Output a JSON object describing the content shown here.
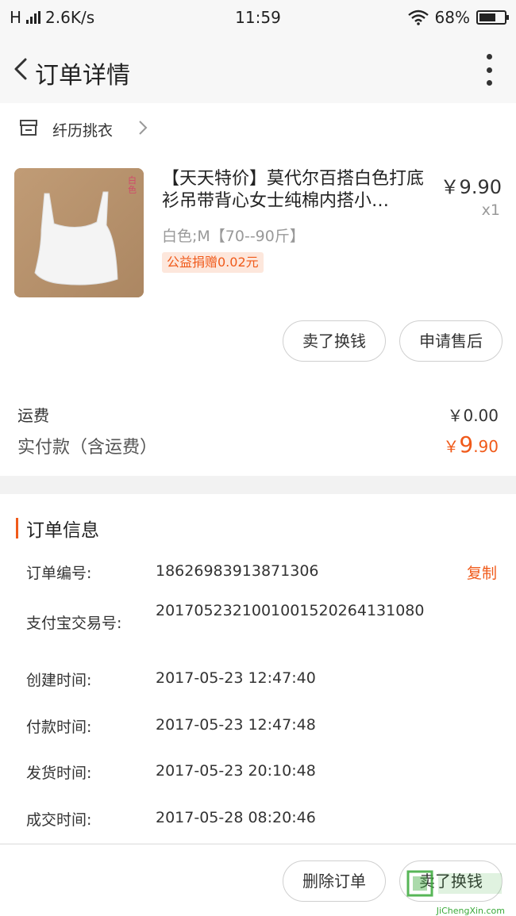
{
  "status_bar": {
    "carrier": "H",
    "speed": "2.6K/s",
    "time": "11:59",
    "battery_text": "68%",
    "battery_level": 0.68
  },
  "navbar": {
    "title": "订单详情"
  },
  "shop": {
    "name": "纤历挑衣"
  },
  "product": {
    "title": "【天天特价】莫代尔百搭白色打底衫吊带背心女士纯棉内搭小…",
    "price": "￥9.90",
    "qty": "x1",
    "sku": "白色;M【70--90斤】",
    "charity": "公益捐赠0.02元",
    "image_tag": "白色"
  },
  "actions_top": {
    "sell": "卖了换钱",
    "after_sales": "申请售后"
  },
  "fees": {
    "shipping_label": "运费",
    "shipping_value": "￥0.00",
    "paid_label": "实付款（含运费）",
    "paid_currency": "￥",
    "paid_int": "9",
    "paid_dec": ".90"
  },
  "order_info": {
    "heading": "订单信息",
    "copy": "复制",
    "rows": [
      {
        "label": "订单编号:",
        "value": "186269839138713​06"
      },
      {
        "label": "支付宝交易号:",
        "value": "2017052321001001520264131080"
      },
      {
        "label": "创建时间:",
        "value": "2017-05-23 12:47:40"
      },
      {
        "label": "付款时间:",
        "value": "2017-05-23 12:47:48"
      },
      {
        "label": "发货时间:",
        "value": "2017-05-23 20:10:48"
      },
      {
        "label": "成交时间:",
        "value": "2017-05-28 08:20:46"
      }
    ]
  },
  "bottom_actions": {
    "delete": "删除订单",
    "sell": "卖了换钱"
  },
  "watermark": {
    "text": "JiChengXin.com"
  },
  "colors": {
    "accent": "#f05a1a",
    "charity_bg": "#fde7dc",
    "page_bg": "#f2f2f2"
  }
}
